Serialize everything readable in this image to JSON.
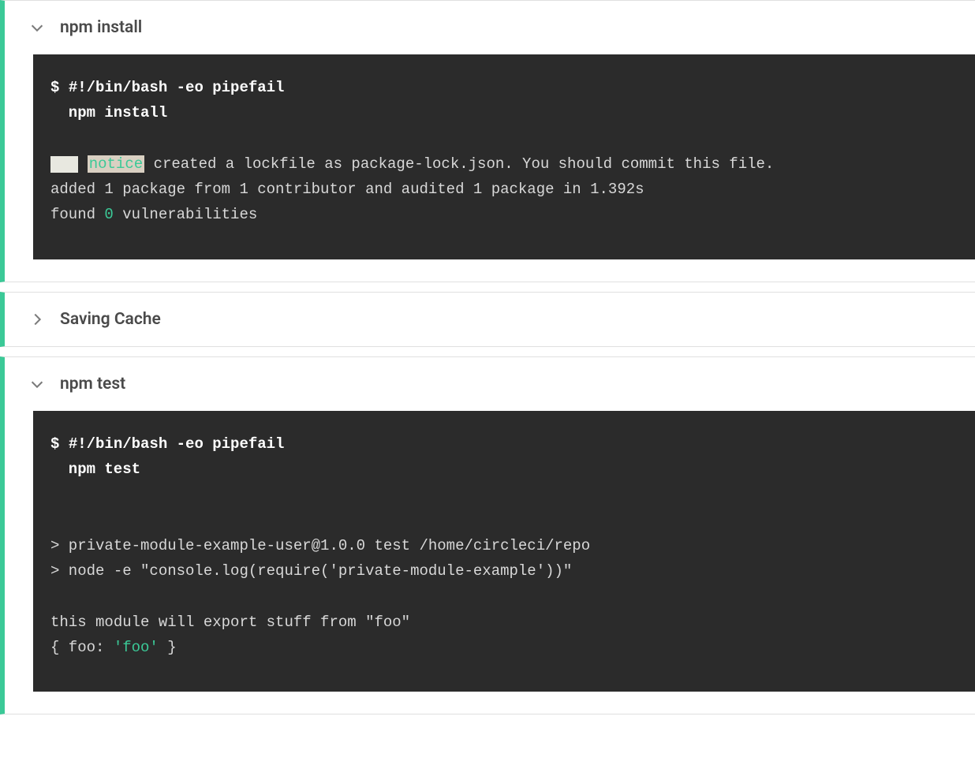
{
  "steps": [
    {
      "title": "npm install",
      "expanded": true,
      "cmd_prompt": "$ ",
      "cmd_head": "#!/bin/bash -eo pipefail",
      "cmd_sub": "npm install",
      "out_notice_label": "notice",
      "out_notice_rest": " created a lockfile as package-lock.json. You should commit this file.",
      "out_line2_a": "added 1 package from 1 contributor and audited 1 package in 1.392s",
      "out_line3_a": "found ",
      "out_line3_num": "0",
      "out_line3_b": " vulnerabilities"
    },
    {
      "title": "Saving Cache",
      "expanded": false
    },
    {
      "title": "npm test",
      "expanded": true,
      "cmd_prompt": "$ ",
      "cmd_head": "#!/bin/bash -eo pipefail",
      "cmd_sub": "npm test",
      "out_blank1": "",
      "out_line1": "> private-module-example-user@1.0.0 test /home/circleci/repo",
      "out_line2": "> node -e \"console.log(require('private-module-example'))\"",
      "out_blank2": "",
      "out_line3": "this module will export stuff from \"foo\"",
      "out_line4_a": "{ foo: ",
      "out_line4_str": "'foo'",
      "out_line4_b": " }"
    }
  ]
}
